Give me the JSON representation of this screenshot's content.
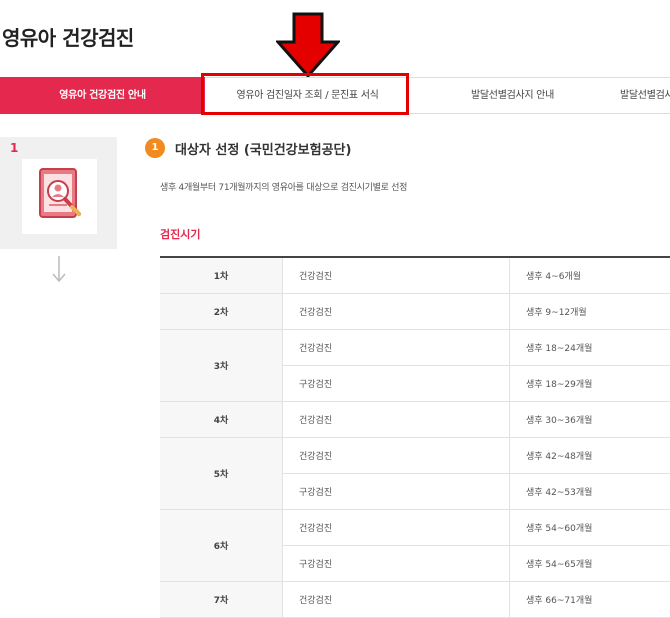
{
  "page": {
    "title": "영유아 건강검진"
  },
  "tabs": [
    {
      "label": "영유아 건강검진 안내",
      "active": true
    },
    {
      "label": "영유아 검진일자 조회 / 문진표 서식",
      "active": false
    },
    {
      "label": "발달선별검사지 안내",
      "active": false
    },
    {
      "label": "발달선별검사",
      "active": false
    }
  ],
  "step": {
    "number": "1",
    "icon": "document-search-icon"
  },
  "section": {
    "badge": "1",
    "title": "대상자 선정 (국민건강보험공단)",
    "description": "생후 4개월부터 71개월까지의 영유아를 대상으로 검진시기별로 선정",
    "schedule_title": "검진시기"
  },
  "colors": {
    "accent": "#e5294e",
    "badge": "#f18a1f",
    "highlight": "#e50000"
  },
  "schedule": [
    {
      "round": "1차",
      "rows": [
        {
          "type": "건강검진",
          "age": "생후 4~6개월"
        }
      ]
    },
    {
      "round": "2차",
      "rows": [
        {
          "type": "건강검진",
          "age": "생후 9~12개월"
        }
      ]
    },
    {
      "round": "3차",
      "rows": [
        {
          "type": "건강검진",
          "age": "생후 18~24개월"
        },
        {
          "type": "구강검진",
          "age": "생후 18~29개월"
        }
      ]
    },
    {
      "round": "4차",
      "rows": [
        {
          "type": "건강검진",
          "age": "생후 30~36개월"
        }
      ]
    },
    {
      "round": "5차",
      "rows": [
        {
          "type": "건강검진",
          "age": "생후 42~48개월"
        },
        {
          "type": "구강검진",
          "age": "생후 42~53개월"
        }
      ]
    },
    {
      "round": "6차",
      "rows": [
        {
          "type": "건강검진",
          "age": "생후 54~60개월"
        },
        {
          "type": "구강검진",
          "age": "생후 54~65개월"
        }
      ]
    },
    {
      "round": "7차",
      "rows": [
        {
          "type": "건강검진",
          "age": "생후 66~71개월"
        }
      ]
    }
  ]
}
